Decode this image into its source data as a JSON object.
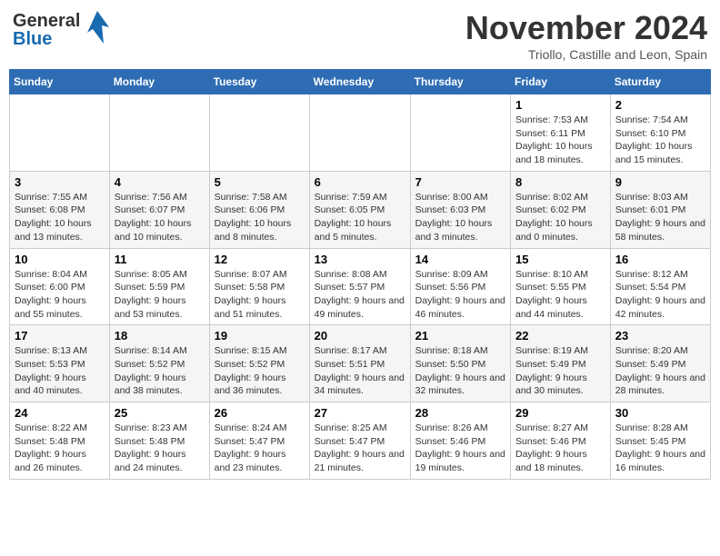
{
  "logo": {
    "general": "General",
    "blue": "Blue"
  },
  "header": {
    "month": "November 2024",
    "location": "Triollo, Castille and Leon, Spain"
  },
  "days_of_week": [
    "Sunday",
    "Monday",
    "Tuesday",
    "Wednesday",
    "Thursday",
    "Friday",
    "Saturday"
  ],
  "weeks": [
    [
      {
        "day": "",
        "info": ""
      },
      {
        "day": "",
        "info": ""
      },
      {
        "day": "",
        "info": ""
      },
      {
        "day": "",
        "info": ""
      },
      {
        "day": "",
        "info": ""
      },
      {
        "day": "1",
        "info": "Sunrise: 7:53 AM\nSunset: 6:11 PM\nDaylight: 10 hours and 18 minutes."
      },
      {
        "day": "2",
        "info": "Sunrise: 7:54 AM\nSunset: 6:10 PM\nDaylight: 10 hours and 15 minutes."
      }
    ],
    [
      {
        "day": "3",
        "info": "Sunrise: 7:55 AM\nSunset: 6:08 PM\nDaylight: 10 hours and 13 minutes."
      },
      {
        "day": "4",
        "info": "Sunrise: 7:56 AM\nSunset: 6:07 PM\nDaylight: 10 hours and 10 minutes."
      },
      {
        "day": "5",
        "info": "Sunrise: 7:58 AM\nSunset: 6:06 PM\nDaylight: 10 hours and 8 minutes."
      },
      {
        "day": "6",
        "info": "Sunrise: 7:59 AM\nSunset: 6:05 PM\nDaylight: 10 hours and 5 minutes."
      },
      {
        "day": "7",
        "info": "Sunrise: 8:00 AM\nSunset: 6:03 PM\nDaylight: 10 hours and 3 minutes."
      },
      {
        "day": "8",
        "info": "Sunrise: 8:02 AM\nSunset: 6:02 PM\nDaylight: 10 hours and 0 minutes."
      },
      {
        "day": "9",
        "info": "Sunrise: 8:03 AM\nSunset: 6:01 PM\nDaylight: 9 hours and 58 minutes."
      }
    ],
    [
      {
        "day": "10",
        "info": "Sunrise: 8:04 AM\nSunset: 6:00 PM\nDaylight: 9 hours and 55 minutes."
      },
      {
        "day": "11",
        "info": "Sunrise: 8:05 AM\nSunset: 5:59 PM\nDaylight: 9 hours and 53 minutes."
      },
      {
        "day": "12",
        "info": "Sunrise: 8:07 AM\nSunset: 5:58 PM\nDaylight: 9 hours and 51 minutes."
      },
      {
        "day": "13",
        "info": "Sunrise: 8:08 AM\nSunset: 5:57 PM\nDaylight: 9 hours and 49 minutes."
      },
      {
        "day": "14",
        "info": "Sunrise: 8:09 AM\nSunset: 5:56 PM\nDaylight: 9 hours and 46 minutes."
      },
      {
        "day": "15",
        "info": "Sunrise: 8:10 AM\nSunset: 5:55 PM\nDaylight: 9 hours and 44 minutes."
      },
      {
        "day": "16",
        "info": "Sunrise: 8:12 AM\nSunset: 5:54 PM\nDaylight: 9 hours and 42 minutes."
      }
    ],
    [
      {
        "day": "17",
        "info": "Sunrise: 8:13 AM\nSunset: 5:53 PM\nDaylight: 9 hours and 40 minutes."
      },
      {
        "day": "18",
        "info": "Sunrise: 8:14 AM\nSunset: 5:52 PM\nDaylight: 9 hours and 38 minutes."
      },
      {
        "day": "19",
        "info": "Sunrise: 8:15 AM\nSunset: 5:52 PM\nDaylight: 9 hours and 36 minutes."
      },
      {
        "day": "20",
        "info": "Sunrise: 8:17 AM\nSunset: 5:51 PM\nDaylight: 9 hours and 34 minutes."
      },
      {
        "day": "21",
        "info": "Sunrise: 8:18 AM\nSunset: 5:50 PM\nDaylight: 9 hours and 32 minutes."
      },
      {
        "day": "22",
        "info": "Sunrise: 8:19 AM\nSunset: 5:49 PM\nDaylight: 9 hours and 30 minutes."
      },
      {
        "day": "23",
        "info": "Sunrise: 8:20 AM\nSunset: 5:49 PM\nDaylight: 9 hours and 28 minutes."
      }
    ],
    [
      {
        "day": "24",
        "info": "Sunrise: 8:22 AM\nSunset: 5:48 PM\nDaylight: 9 hours and 26 minutes."
      },
      {
        "day": "25",
        "info": "Sunrise: 8:23 AM\nSunset: 5:48 PM\nDaylight: 9 hours and 24 minutes."
      },
      {
        "day": "26",
        "info": "Sunrise: 8:24 AM\nSunset: 5:47 PM\nDaylight: 9 hours and 23 minutes."
      },
      {
        "day": "27",
        "info": "Sunrise: 8:25 AM\nSunset: 5:47 PM\nDaylight: 9 hours and 21 minutes."
      },
      {
        "day": "28",
        "info": "Sunrise: 8:26 AM\nSunset: 5:46 PM\nDaylight: 9 hours and 19 minutes."
      },
      {
        "day": "29",
        "info": "Sunrise: 8:27 AM\nSunset: 5:46 PM\nDaylight: 9 hours and 18 minutes."
      },
      {
        "day": "30",
        "info": "Sunrise: 8:28 AM\nSunset: 5:45 PM\nDaylight: 9 hours and 16 minutes."
      }
    ]
  ]
}
